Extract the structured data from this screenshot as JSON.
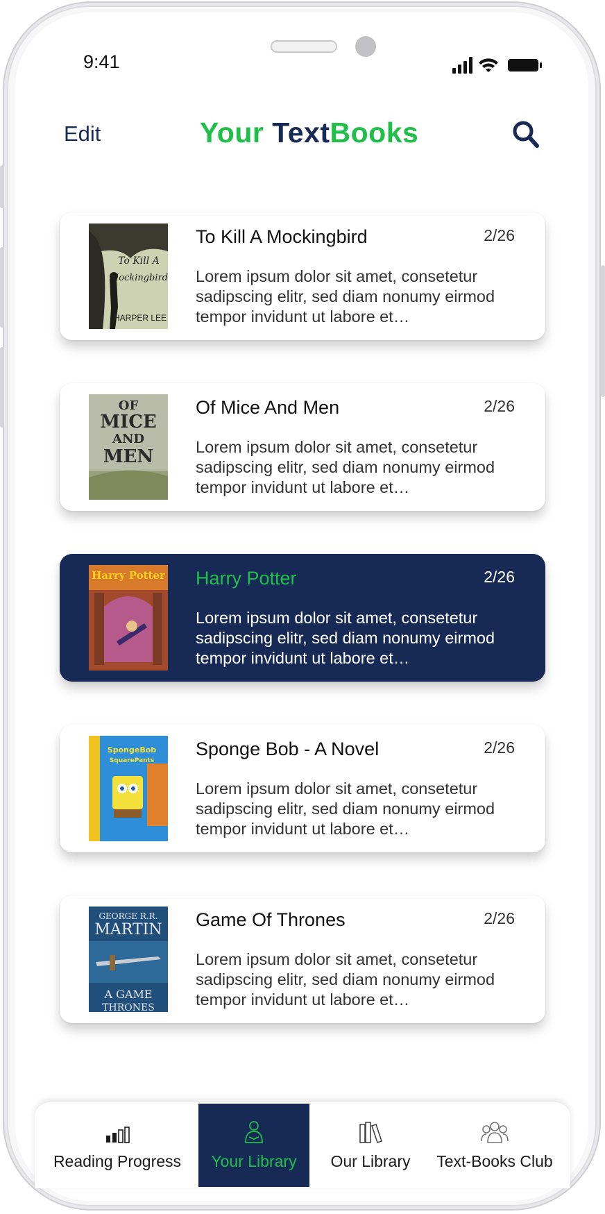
{
  "status_bar": {
    "time": "9:41"
  },
  "header": {
    "edit_label": "Edit",
    "title_part1": "Your ",
    "title_part2": "Text",
    "title_part3": "Books"
  },
  "books": [
    {
      "title": "To Kill A Mockingbird",
      "count": "2/26",
      "description": "Lorem ipsum dolor sit amet, consetetur sadipscing elitr, sed diam nonumy eirmod tempor invidunt ut labore et…",
      "cover_author": "HARPER LEE"
    },
    {
      "title": "Of Mice And Men",
      "count": "2/26",
      "description": "Lorem ipsum dolor sit amet, consetetur sadipscing elitr, sed diam nonumy eirmod tempor invidunt ut labore et…",
      "cover_title": "OF MICE AND MEN"
    },
    {
      "title": "Harry Potter",
      "count": "2/26",
      "description": "Lorem ipsum dolor sit amet, consetetur sadipscing elitr, sed diam nonumy eirmod tempor invidunt ut labore et…",
      "cover_title": "Harry Potter"
    },
    {
      "title": "Sponge Bob - A Novel",
      "count": "2/26",
      "description": "Lorem ipsum dolor sit amet, consetetur sadipscing elitr, sed diam nonumy eirmod tempor invidunt ut labore et…",
      "cover_title": "SpongeBob SquarePants"
    },
    {
      "title": "Game Of Thrones",
      "count": "2/26",
      "description": "Lorem ipsum dolor sit amet, consetetur sadipscing elitr, sed diam nonumy eirmod tempor invidunt ut labore et…",
      "cover_author": "GEORGE R.R. MARTIN",
      "cover_title": "A GAME OF THRONES"
    }
  ],
  "selected_book": "Harry Potter",
  "nav": {
    "active": "Your Library",
    "items": [
      {
        "label": "Reading Progress",
        "icon": "bar-chart-icon"
      },
      {
        "label": "Your Library",
        "icon": "reader-person-icon"
      },
      {
        "label": "Our Library",
        "icon": "books-icon"
      },
      {
        "label": "Text-Books Club",
        "icon": "group-icon"
      }
    ]
  },
  "colors": {
    "accent_green": "#1fbf4a",
    "navy": "#172a55",
    "card_bg": "#ffffff"
  }
}
